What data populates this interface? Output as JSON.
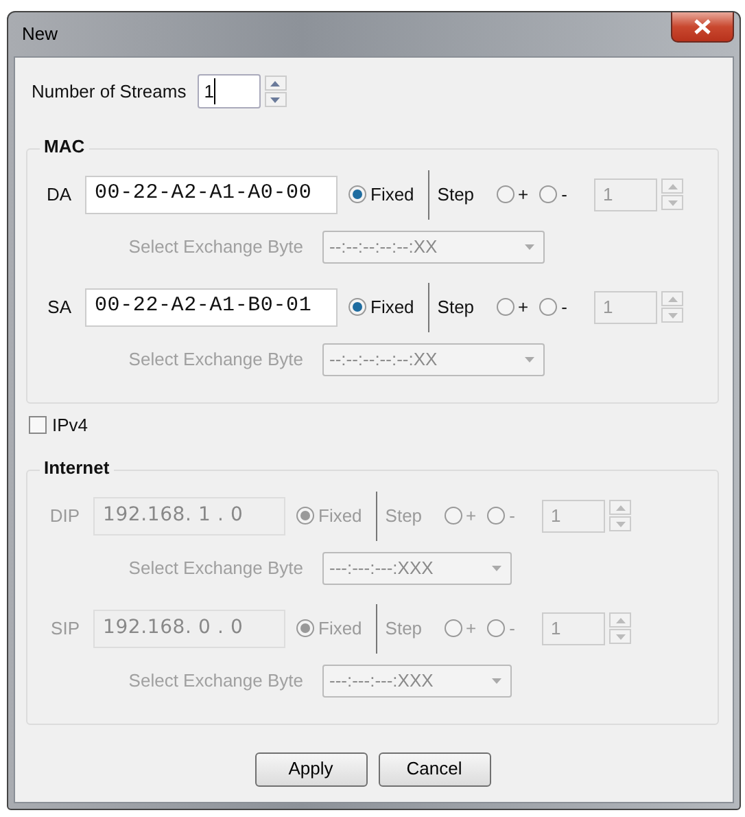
{
  "window": {
    "title": "New"
  },
  "streams": {
    "label": "Number of Streams",
    "value": "1"
  },
  "groups": [
    {
      "title": "MAC",
      "disabled": false,
      "kind": "mac",
      "rows": [
        {
          "label": "DA",
          "address": "00-22-A2-A1-A0-00",
          "fixed": true,
          "fixed_label": "Fixed",
          "step_label": "Step",
          "plus": false,
          "plus_label": "+",
          "minus": false,
          "minus_label": "-",
          "step": "1",
          "exchange_label": "Select Exchange Byte",
          "exchange_value": "--:--:--:--:--:XX"
        },
        {
          "label": "SA",
          "address": "00-22-A2-A1-B0-01",
          "fixed": true,
          "fixed_label": "Fixed",
          "step_label": "Step",
          "plus": false,
          "plus_label": "+",
          "minus": false,
          "minus_label": "-",
          "step": "1",
          "exchange_label": "Select Exchange Byte",
          "exchange_value": "--:--:--:--:--:XX"
        }
      ]
    },
    {
      "toggle": {
        "label": "IPv4",
        "checked": false
      },
      "title": "Internet",
      "disabled": true,
      "kind": "ip",
      "rows": [
        {
          "label": "DIP",
          "address": "192.168. 1 . 0",
          "fixed": true,
          "fixed_label": "Fixed",
          "step_label": "Step",
          "plus": false,
          "plus_label": "+",
          "minus": false,
          "minus_label": "-",
          "step": "1",
          "exchange_label": "Select Exchange Byte",
          "exchange_value": "---:---:---:XXX"
        },
        {
          "label": "SIP",
          "address": "192.168. 0 . 0",
          "fixed": true,
          "fixed_label": "Fixed",
          "step_label": "Step",
          "plus": false,
          "plus_label": "+",
          "minus": false,
          "minus_label": "-",
          "step": "1",
          "exchange_label": "Select Exchange Byte",
          "exchange_value": "---:---:---:XXX"
        }
      ]
    }
  ],
  "buttons": [
    "Apply",
    "Cancel"
  ]
}
